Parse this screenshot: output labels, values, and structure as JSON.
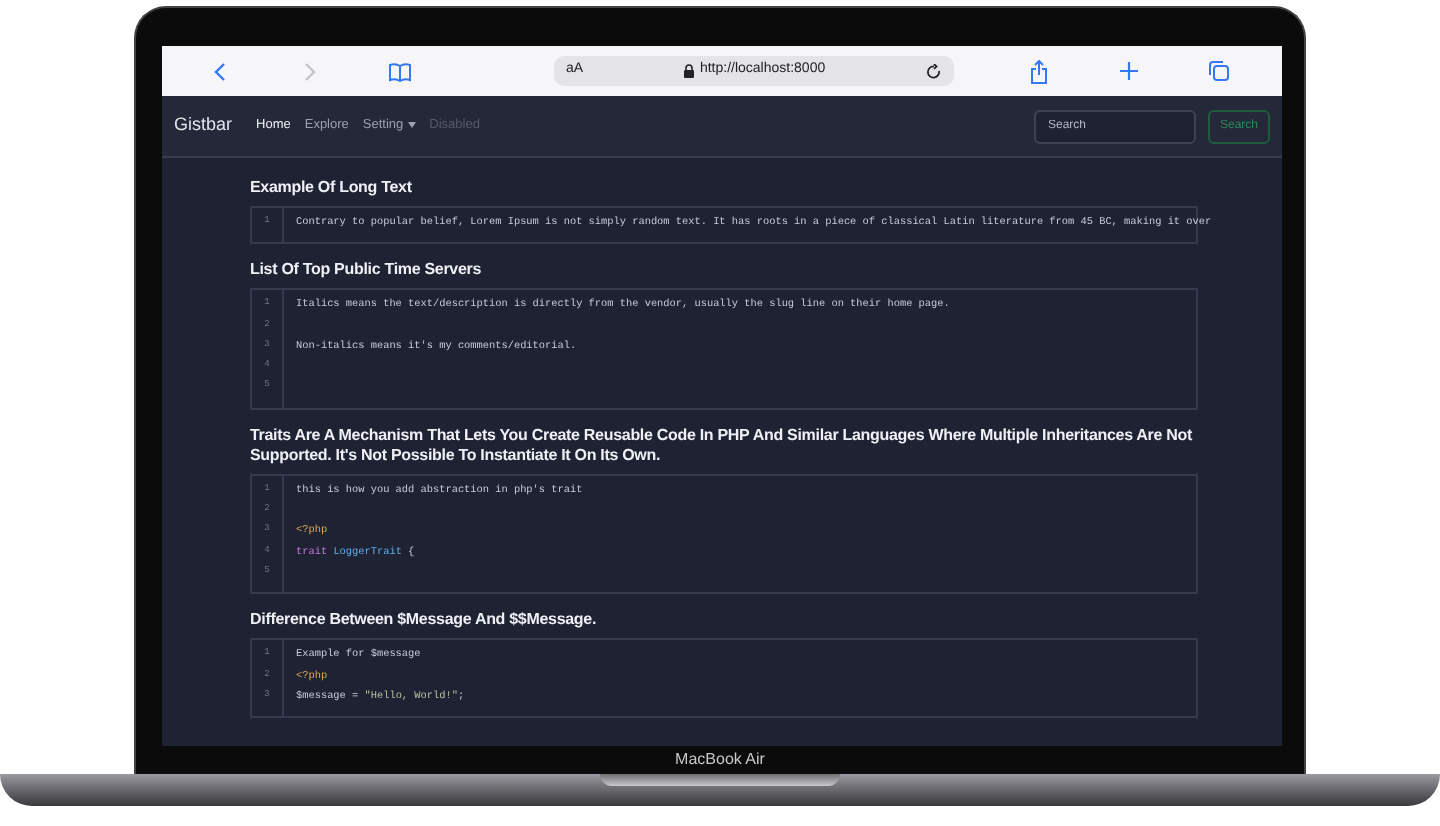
{
  "browser": {
    "text_size_button": "aA",
    "url": "http://localhost:8000"
  },
  "navbar": {
    "brand": "Gistbar",
    "links": [
      {
        "label": "Home",
        "kind": "link",
        "selected": true,
        "disabled": false
      },
      {
        "label": "Explore",
        "kind": "link",
        "selected": false,
        "disabled": false
      },
      {
        "label": "Setting",
        "kind": "dropdown",
        "selected": false,
        "disabled": false
      },
      {
        "label": "Disabled",
        "kind": "link",
        "selected": false,
        "disabled": true
      }
    ],
    "search": {
      "placeholder": "Search",
      "button": "Search"
    }
  },
  "gists": [
    {
      "title": "Example Of Long Text",
      "lines": [
        {
          "number": "1",
          "tokens": [
            {
              "kind": "plain",
              "text": "Contrary to popular belief, Lorem Ipsum is not simply random text. It has roots in a piece of classical Latin literature from 45 BC, making it over"
            }
          ]
        }
      ]
    },
    {
      "title": "List Of Top Public Time Servers",
      "lines": [
        {
          "number": "1",
          "tokens": [
            {
              "kind": "plain",
              "text": "Italics means the text/description is directly from the vendor, usually the slug line on their home page."
            }
          ]
        },
        {
          "number": "2"
        },
        {
          "number": "3",
          "tokens": [
            {
              "kind": "plain",
              "text": "Non-italics means it's my comments/editorial."
            }
          ]
        },
        {
          "number": "4"
        },
        {
          "number": "5"
        }
      ]
    },
    {
      "title": "Traits Are A Mechanism That Lets You Create Reusable Code In PHP And Similar Languages Where Multiple Inheritances Are Not Supported. It's Not Possible To Instantiate It On Its Own.",
      "lines": [
        {
          "number": "1",
          "tokens": [
            {
              "kind": "plain",
              "text": "this is how you add abstraction in php's trait"
            }
          ]
        },
        {
          "number": "2"
        },
        {
          "number": "3",
          "tokens": [
            {
              "kind": "tag",
              "text": "<?php"
            }
          ]
        },
        {
          "number": "4",
          "tokens": [
            {
              "kind": "keyword",
              "text": "trait "
            },
            {
              "kind": "class",
              "text": "LoggerTrait"
            },
            {
              "kind": "plain",
              "text": " {"
            }
          ]
        },
        {
          "number": "5"
        }
      ]
    },
    {
      "title": "Difference Between $Message And $$Message.",
      "lines": [
        {
          "number": "1",
          "tokens": [
            {
              "kind": "plain",
              "text": "Example for $message"
            }
          ]
        },
        {
          "number": "2",
          "tokens": [
            {
              "kind": "tag",
              "text": "<?php"
            }
          ]
        },
        {
          "number": "3",
          "tokens": [
            {
              "kind": "plain",
              "text": "$message = "
            },
            {
              "kind": "string",
              "text": "\"Hello, World!\""
            },
            {
              "kind": "plain",
              "text": ";"
            }
          ]
        }
      ]
    }
  ],
  "device": {
    "label": "MacBook Air"
  }
}
